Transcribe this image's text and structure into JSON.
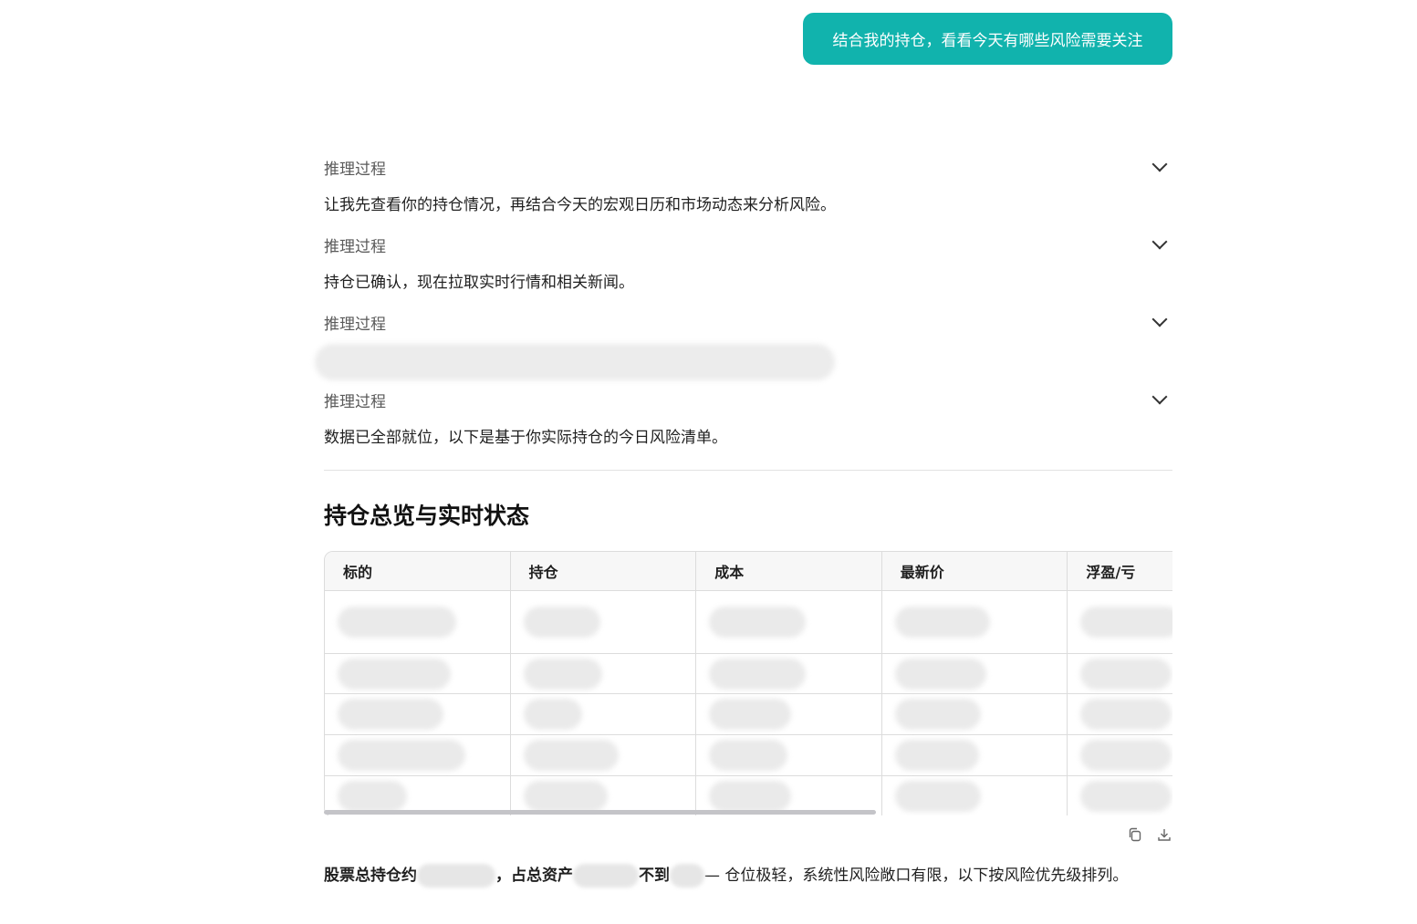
{
  "user_message": "结合我的持仓，看看今天有哪些风险需要关注",
  "reasoning": [
    {
      "label": "推理过程",
      "text": "让我先查看你的持仓情况，再结合今天的宏观日历和市场动态来分析风险。"
    },
    {
      "label": "推理过程",
      "text": "持仓已确认，现在拉取实时行情和相关新闻。"
    },
    {
      "label": "推理过程",
      "text": ""
    },
    {
      "label": "推理过程",
      "text": "数据已全部就位，以下是基于你实际持仓的今日风险清单。"
    }
  ],
  "section_title": "持仓总览与实时状态",
  "table": {
    "headers": [
      "标的",
      "持仓",
      "成本",
      "最新价",
      "浮盈/亏"
    ]
  },
  "summary": {
    "part1": "股票总持仓约",
    "part2": "，占总资产",
    "part3": "不到",
    "part4": "— 仓位极轻，系统性风险敞口有限，以下按风险优先级排列。"
  },
  "icons": {
    "copy": "copy-icon",
    "download": "download-icon",
    "chevron": "chevron-down-icon"
  },
  "colors": {
    "accent": "#11b3ad"
  }
}
